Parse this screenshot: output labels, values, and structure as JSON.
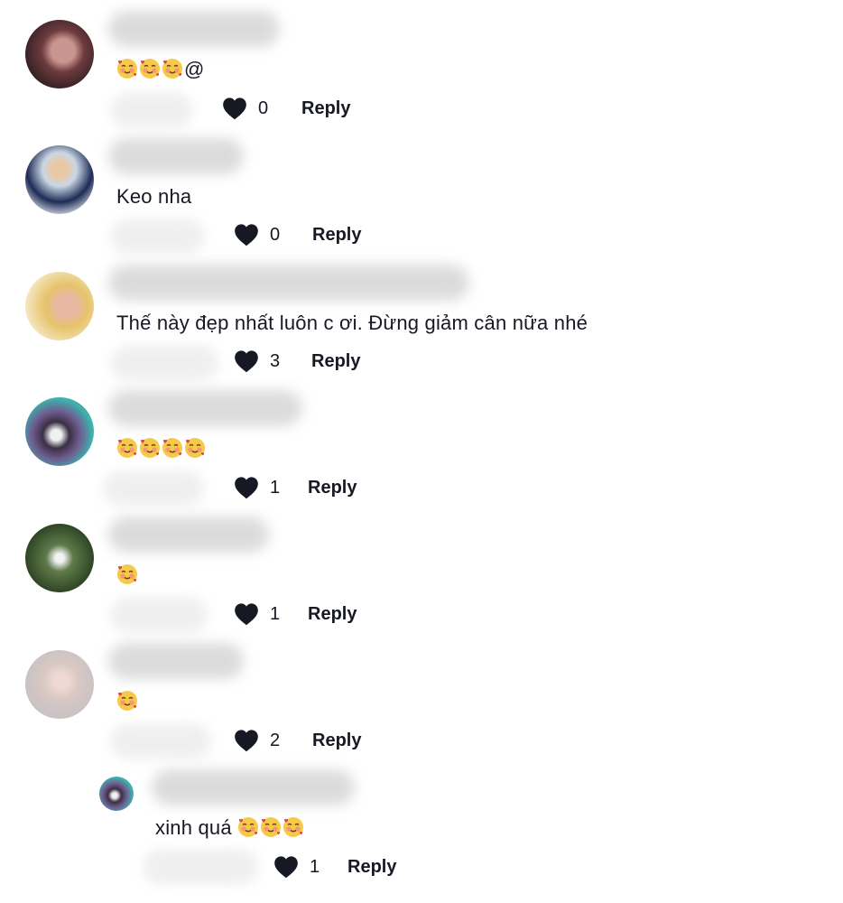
{
  "reply_label": "Reply",
  "colors": {
    "text": "#161823",
    "background": "#ffffff",
    "heart": "#161823"
  },
  "comments": [
    {
      "text": "",
      "emoji_count": 3,
      "suffix": "@",
      "likes": "0"
    },
    {
      "text": "Keo nha",
      "likes": "0"
    },
    {
      "text": "Thế này đẹp nhất luôn c ơi. Đừng giảm cân nữa nhé",
      "likes": "3"
    },
    {
      "text": "",
      "emoji_count": 4,
      "likes": "1"
    },
    {
      "text": "",
      "emoji_count": 1,
      "likes": "1"
    },
    {
      "text": "",
      "emoji_count": 1,
      "likes": "2"
    }
  ],
  "reply_comment": {
    "text": "xinh quá ",
    "emoji_count": 3,
    "likes": "1"
  }
}
